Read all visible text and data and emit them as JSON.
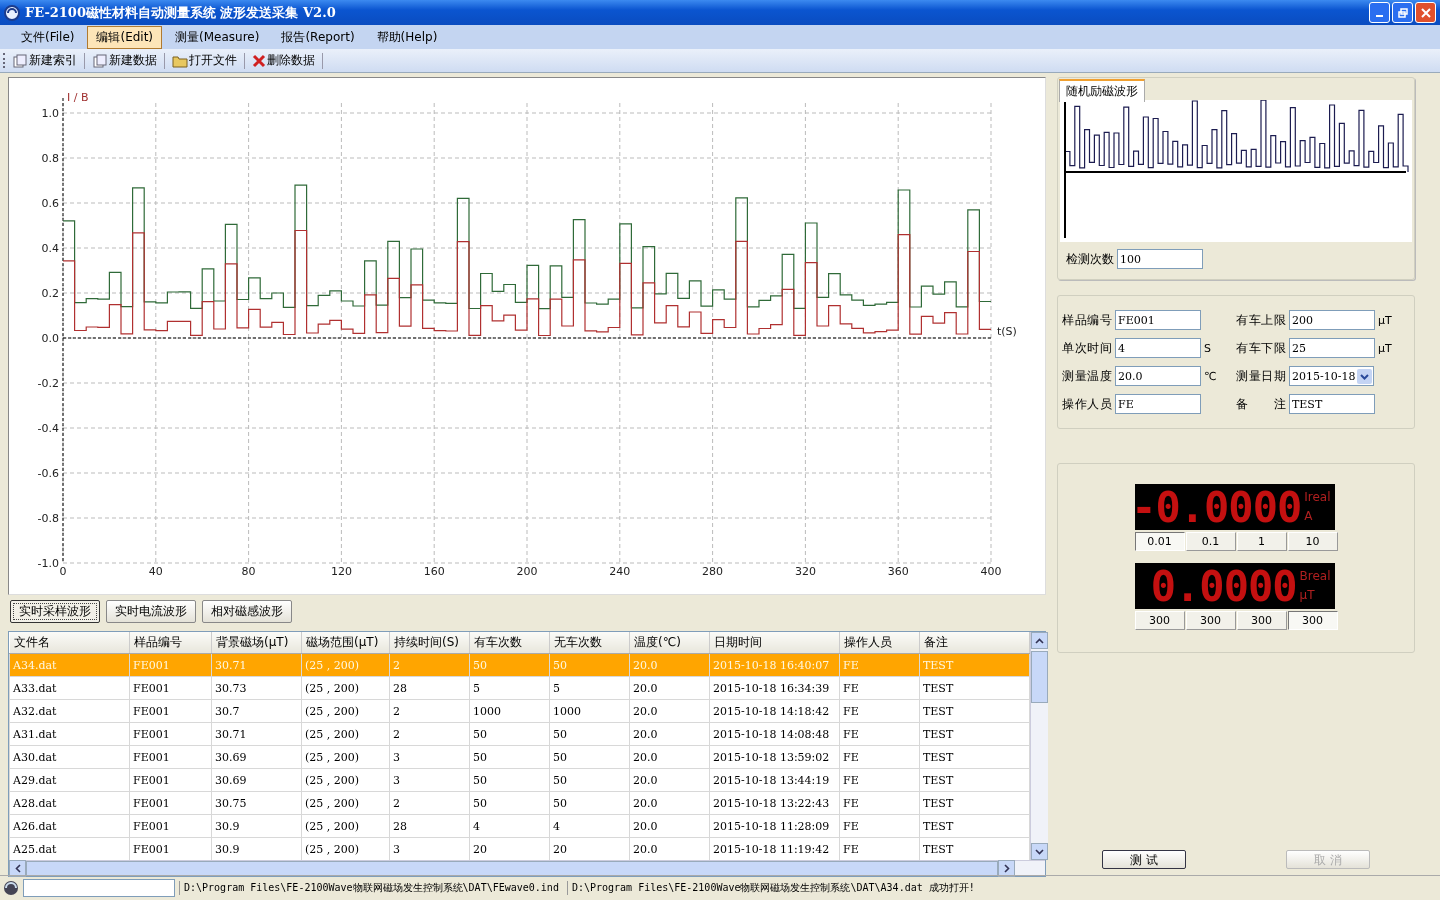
{
  "window": {
    "title": "FE-2100磁性材料自动测量系统 波形发送采集 V2.0"
  },
  "menu": [
    {
      "label": "文件(File)",
      "selected": false
    },
    {
      "label": "编辑(Edit)",
      "selected": true
    },
    {
      "label": "测量(Measure)",
      "selected": false
    },
    {
      "label": "报告(Report)",
      "selected": false
    },
    {
      "label": "帮助(Help)",
      "selected": false
    }
  ],
  "toolbar": [
    {
      "label": "新建索引",
      "kind": "new"
    },
    {
      "label": "新建数据",
      "kind": "new"
    },
    {
      "label": "打开文件",
      "kind": "open"
    },
    {
      "label": "删除数据",
      "kind": "delete"
    }
  ],
  "chart": {
    "y_axis_title": "I / B",
    "x_axis_title": "t(S)",
    "y_ticks": [
      "1.0",
      "0.8",
      "0.6",
      "0.4",
      "0.2",
      "0.0",
      "-0.2",
      "-0.4",
      "-0.6",
      "-0.8",
      "-1.0"
    ],
    "x_ticks": [
      "0",
      "40",
      "80",
      "120",
      "160",
      "200",
      "240",
      "280",
      "320",
      "360",
      "400"
    ]
  },
  "wave_tabs": [
    {
      "label": "实时采样波形",
      "selected": true
    },
    {
      "label": "实时电流波形",
      "selected": false
    },
    {
      "label": "相对磁感波形",
      "selected": false
    }
  ],
  "table": {
    "columns": [
      "文件名",
      "样品编号",
      "背景磁场(μT)",
      "磁场范围(μT)",
      "持续时间(S)",
      "有车次数",
      "无车次数",
      "温度(℃)",
      "日期时间",
      "操作人员",
      "备注"
    ],
    "rows": [
      {
        "selected": true,
        "cells": [
          "A34.dat",
          "FE001",
          "30.71",
          "(25 , 200)",
          "2",
          "50",
          "50",
          "20.0",
          "2015-10-18 16:40:07",
          "FE",
          "TEST"
        ]
      },
      {
        "selected": false,
        "cells": [
          "A33.dat",
          "FE001",
          "30.73",
          "(25 , 200)",
          "28",
          "5",
          "5",
          "20.0",
          "2015-10-18 16:34:39",
          "FE",
          "TEST"
        ]
      },
      {
        "selected": false,
        "cells": [
          "A32.dat",
          "FE001",
          "30.7",
          "(25 , 200)",
          "2",
          "1000",
          "1000",
          "20.0",
          "2015-10-18 14:18:42",
          "FE",
          "TEST"
        ]
      },
      {
        "selected": false,
        "cells": [
          "A31.dat",
          "FE001",
          "30.71",
          "(25 , 200)",
          "2",
          "50",
          "50",
          "20.0",
          "2015-10-18 14:08:48",
          "FE",
          "TEST"
        ]
      },
      {
        "selected": false,
        "cells": [
          "A30.dat",
          "FE001",
          "30.69",
          "(25 , 200)",
          "3",
          "50",
          "50",
          "20.0",
          "2015-10-18 13:59:02",
          "FE",
          "TEST"
        ]
      },
      {
        "selected": false,
        "cells": [
          "A29.dat",
          "FE001",
          "30.69",
          "(25 , 200)",
          "3",
          "50",
          "50",
          "20.0",
          "2015-10-18 13:44:19",
          "FE",
          "TEST"
        ]
      },
      {
        "selected": false,
        "cells": [
          "A28.dat",
          "FE001",
          "30.75",
          "(25 , 200)",
          "2",
          "50",
          "50",
          "20.0",
          "2015-10-18 13:22:43",
          "FE",
          "TEST"
        ]
      },
      {
        "selected": false,
        "cells": [
          "A26.dat",
          "FE001",
          "30.9",
          "(25 , 200)",
          "28",
          "4",
          "4",
          "20.0",
          "2015-10-18 11:28:09",
          "FE",
          "TEST"
        ]
      },
      {
        "selected": false,
        "cells": [
          "A25.dat",
          "FE001",
          "30.9",
          "(25 , 200)",
          "3",
          "20",
          "20",
          "20.0",
          "2015-10-18 11:19:42",
          "FE",
          "TEST"
        ]
      }
    ]
  },
  "excitation": {
    "tab": "随机励磁波形",
    "count_label": "检测次数",
    "count": "100"
  },
  "params": [
    {
      "label": "样品编号",
      "value": "FE001",
      "kind": "text"
    },
    {
      "label": "有车上限",
      "value": "200",
      "unit": "μT",
      "kind": "text"
    },
    {
      "label": "单次时间",
      "value": "4",
      "unit": "S",
      "kind": "text"
    },
    {
      "label": "有车下限",
      "value": "25",
      "unit": "μT",
      "kind": "text"
    },
    {
      "label": "测量温度",
      "value": "20.0",
      "unit": "℃",
      "kind": "text"
    },
    {
      "label": "测量日期",
      "value": "2015-10-18",
      "kind": "date"
    },
    {
      "label": "操作人员",
      "value": "FE",
      "kind": "text"
    },
    {
      "label": "备 注",
      "value": "TEST",
      "kind": "text"
    }
  ],
  "meters": [
    {
      "reading": "-0.0000",
      "name": "Ireal",
      "unit": "A",
      "ranges": [
        {
          "label": "0.01",
          "selected": true
        },
        {
          "label": "0.1",
          "selected": false
        },
        {
          "label": "1",
          "selected": false
        },
        {
          "label": "10",
          "selected": false
        }
      ]
    },
    {
      "reading": "0.0000",
      "name": "Breal",
      "unit": "μT",
      "ranges": [
        {
          "label": "300",
          "selected": false
        },
        {
          "label": "300",
          "selected": false
        },
        {
          "label": "300",
          "selected": false
        },
        {
          "label": "300",
          "selected": true
        }
      ]
    }
  ],
  "actions": [
    {
      "label": "测 试",
      "disabled": false
    },
    {
      "label": "取 消",
      "disabled": true
    }
  ],
  "status_bar": {
    "texts": [
      "D:\\Program Files\\FE-2100Wave物联网磁场发生控制系统\\DAT\\FEwave0.ind",
      "D:\\Program Files\\FE-2100Wave物联网磁场发生控制系统\\DAT\\A34.dat 成功打开!"
    ]
  }
}
